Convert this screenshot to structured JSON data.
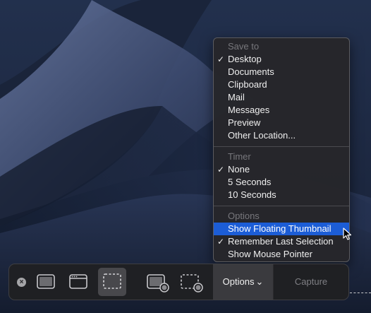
{
  "desktop": {
    "wallpaper": "mojave-night-dunes"
  },
  "menu": {
    "save_to": {
      "label": "Save to",
      "items": [
        {
          "label": "Desktop",
          "checked": true
        },
        {
          "label": "Documents",
          "checked": false
        },
        {
          "label": "Clipboard",
          "checked": false
        },
        {
          "label": "Mail",
          "checked": false
        },
        {
          "label": "Messages",
          "checked": false
        },
        {
          "label": "Preview",
          "checked": false
        },
        {
          "label": "Other Location...",
          "checked": false
        }
      ]
    },
    "timer": {
      "label": "Timer",
      "items": [
        {
          "label": "None",
          "checked": true
        },
        {
          "label": "5 Seconds",
          "checked": false
        },
        {
          "label": "10 Seconds",
          "checked": false
        }
      ]
    },
    "options": {
      "label": "Options",
      "items": [
        {
          "label": "Show Floating Thumbnail",
          "checked": false,
          "highlighted": true
        },
        {
          "label": "Remember Last Selection",
          "checked": true
        },
        {
          "label": "Show Mouse Pointer",
          "checked": false
        }
      ]
    },
    "checkmark": "✓"
  },
  "toolbar": {
    "close_glyph": "×",
    "tools": [
      "capture-entire-screen",
      "capture-selected-window",
      "capture-selected-portion",
      "record-entire-screen",
      "record-selected-portion"
    ],
    "selected_tool": "capture-selected-portion",
    "options_label": "Options",
    "options_chevron": "⌄",
    "capture_label": "Capture"
  },
  "colors": {
    "menu_highlight": "#1c5dd6",
    "menu_bg": "#26262a",
    "toolbar_bg": "#202023",
    "wallpaper_dark": "#1b2438",
    "wallpaper_light": "#5a6a93"
  }
}
